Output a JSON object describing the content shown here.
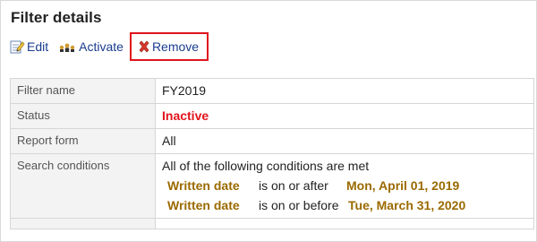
{
  "page": {
    "title": "Filter details"
  },
  "toolbar": {
    "edit_label": "Edit",
    "activate_label": "Activate",
    "remove_label": "Remove"
  },
  "details": {
    "filter_name": {
      "label": "Filter name",
      "value": "FY2019"
    },
    "status": {
      "label": "Status",
      "value": "Inactive"
    },
    "report_form": {
      "label": "Report form",
      "value": "All"
    },
    "search_conditions": {
      "label": "Search conditions",
      "summary": "All of the following conditions are met",
      "conditions": [
        {
          "field": "Written date",
          "operator": "is on or after",
          "value": "Mon, April 01, 2019"
        },
        {
          "field": "Written date",
          "operator": "is on or before",
          "value": "Tue, March 31, 2020"
        }
      ]
    }
  },
  "colors": {
    "link": "#1a3d8f",
    "status_inactive": "#e0141c",
    "condition_highlight": "#9a6a00",
    "remove_highlight_border": "#e0141c"
  },
  "icons": {
    "edit": "edit-icon",
    "activate": "activate-icon",
    "remove": "remove-icon"
  }
}
